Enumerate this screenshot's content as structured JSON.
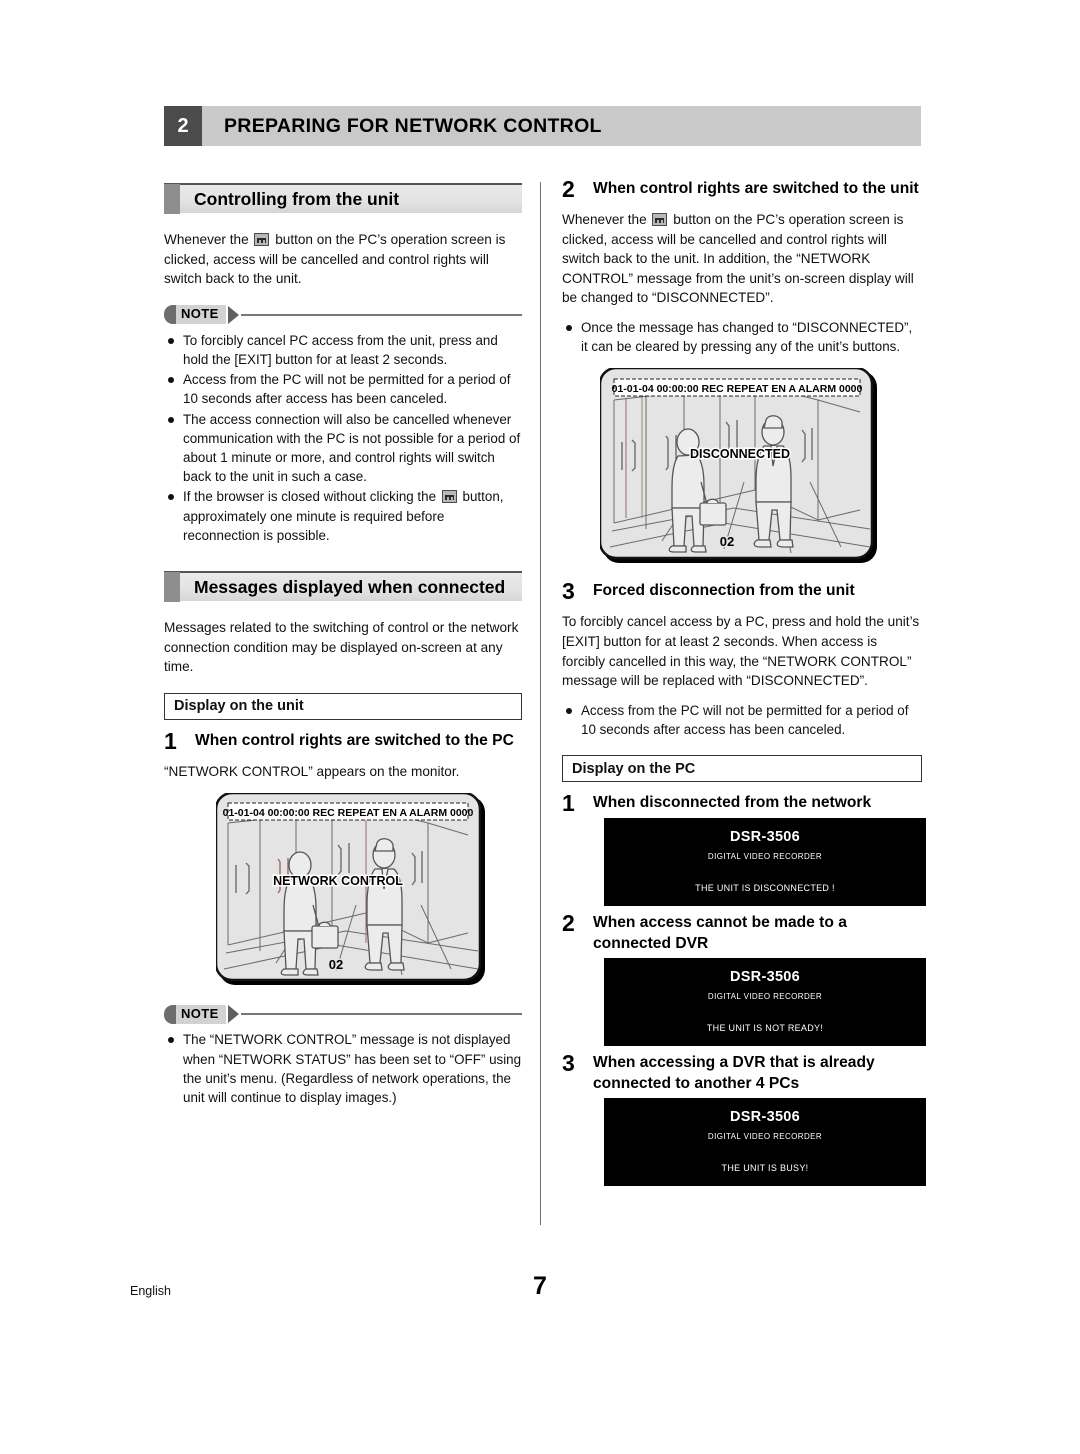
{
  "chapter": {
    "number": "2",
    "title": "PREPARING FOR NETWORK CONTROL"
  },
  "left_column": {
    "section1": {
      "heading": "Controlling from the unit",
      "intro_pre": "Whenever the",
      "intro_post": "button on the PC’s operation screen is clicked, access will be cancelled and control rights will switch back to the unit.",
      "note_label": "NOTE",
      "note_items": [
        "To forcibly cancel PC access from the unit, press and hold the [EXIT] button for at least 2 seconds.",
        "Access from the PC will not be permitted for a period of 10 seconds after access has been canceled.",
        "The access connection will also be cancelled whenever communication with the PC is not possible for a period of about 1 minute or more, and control rights will switch back to the unit in such a case."
      ],
      "note_item_last_pre": "If the browser is closed without clicking the",
      "note_item_last_post": "button, approximately one minute is required before reconnection is possible."
    },
    "section2": {
      "heading": "Messages displayed when connected",
      "intro": "Messages related to the switching of control or the network connection condition may be displayed on-screen at any time.",
      "label_box": "Display on the unit",
      "step": {
        "number": "1",
        "text": "When control rights are switched to the PC"
      },
      "step_body": "“NETWORK CONTROL” appears on the monitor.",
      "monitor": {
        "osd_top": "01-01-04 00:00:00 REC REPEAT EN A ALARM 0000",
        "osd_message": "NETWORK CONTROL",
        "osd_channel": "02"
      },
      "note_label": "NOTE",
      "note_items": [
        "The “NETWORK CONTROL” message is not displayed when “NETWORK STATUS” has been set to “OFF” using the unit’s menu. (Regardless of network operations, the unit will continue to display images.)"
      ]
    }
  },
  "right_column": {
    "step2": {
      "number": "2",
      "text": "When control rights are switched to the unit",
      "body_pre": "Whenever the",
      "body_post": "button on the PC’s operation screen is clicked, access will be cancelled and control rights will switch back to the unit. In addition, the “NETWORK CONTROL” message from the unit’s on-screen display will be changed to “DISCONNECTED”.",
      "bullets": [
        "Once the message has changed to “DISCONNECTED”, it can be cleared by pressing any of the unit’s buttons."
      ],
      "monitor": {
        "osd_top": "01-01-04 00:00:00 REC REPEAT EN A ALARM 0000",
        "osd_message": "DISCONNECTED",
        "osd_channel": "02"
      }
    },
    "step3": {
      "number": "3",
      "text": "Forced disconnection from the unit",
      "body": "To forcibly cancel access by a PC, press and hold the unit’s [EXIT] button for at least 2 seconds. When access is forcibly cancelled in this way, the “NETWORK CONTROL” message will be replaced with “DISCONNECTED”.",
      "bullets": [
        "Access from the PC will not be permitted for a period of 10 seconds after access has been canceled."
      ]
    },
    "label_box": "Display on the PC",
    "pc_steps": [
      {
        "number": "1",
        "text": "When disconnected from the network",
        "screen": {
          "model": "DSR-3506",
          "subtitle": "DIGITAL VIDEO RECORDER",
          "message": "THE UNIT IS DISCONNECTED !"
        }
      },
      {
        "number": "2",
        "text": "When access cannot be made to a connected DVR",
        "screen": {
          "model": "DSR-3506",
          "subtitle": "DIGITAL VIDEO RECORDER",
          "message": "THE UNIT IS NOT READY!"
        }
      },
      {
        "number": "3",
        "text": "When accessing a DVR that is already connected to another 4 PCs",
        "screen": {
          "model": "DSR-3506",
          "subtitle": "DIGITAL VIDEO RECORDER",
          "message": "THE UNIT IS BUSY!"
        }
      }
    ]
  },
  "footer": {
    "language": "English",
    "page_number": "7"
  },
  "colors": {
    "chapter_num_bg": "#4b4b4b",
    "chapter_bar_bg": "#c9c9c9",
    "section_tab": "#8e8e8e",
    "screen_bg": "#000000"
  }
}
